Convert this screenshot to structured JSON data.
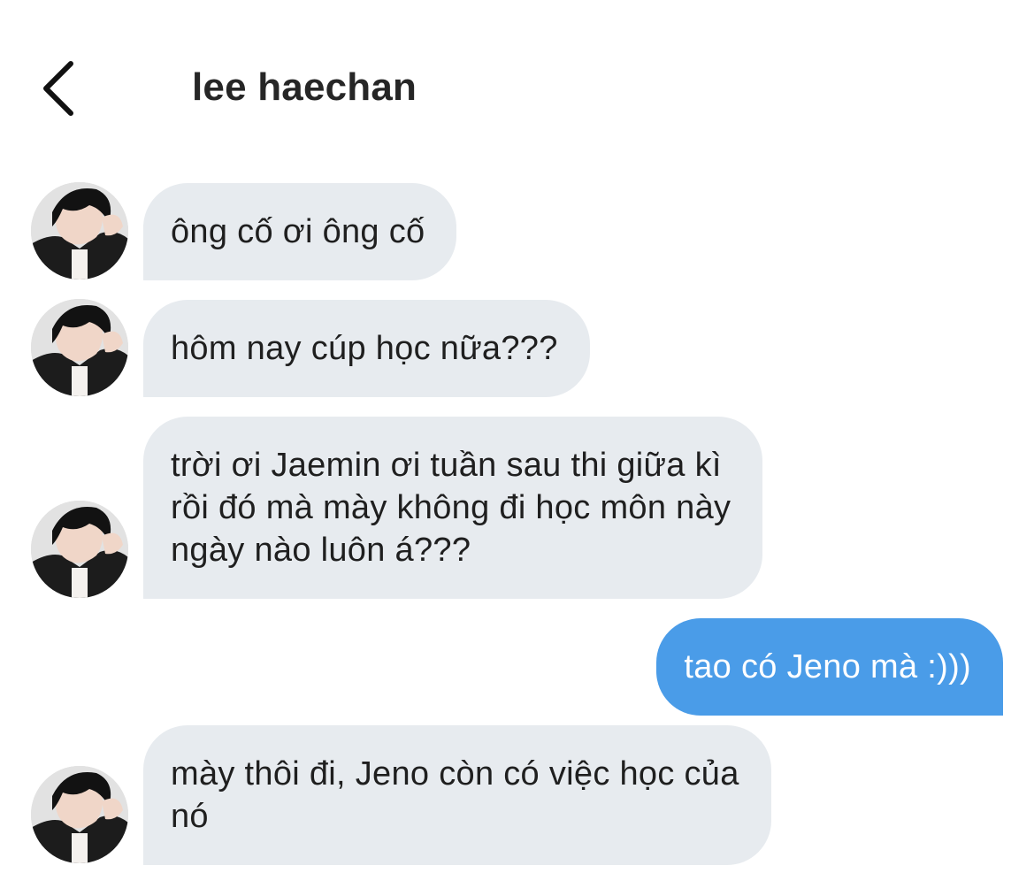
{
  "header": {
    "contact_name": "lee haechan",
    "back_icon": "chevron-left-icon"
  },
  "colors": {
    "incoming_bubble": "#e7ebef",
    "outgoing_bubble": "#4a9ce8",
    "text": "#1f1f1f",
    "outgoing_text": "#ffffff"
  },
  "messages": [
    {
      "direction": "incoming",
      "text": "ông cố ơi ông cố"
    },
    {
      "direction": "incoming",
      "text": "hôm nay cúp học nữa???"
    },
    {
      "direction": "incoming",
      "text": "trời ơi Jaemin ơi tuần sau thi giữa kì\nrồi đó mà mày không đi học môn này\nngày nào luôn á???"
    },
    {
      "direction": "outgoing",
      "text": "tao có Jeno mà :)))"
    },
    {
      "direction": "incoming",
      "text": "mày thôi đi, Jeno còn có việc học của\nnó"
    }
  ]
}
